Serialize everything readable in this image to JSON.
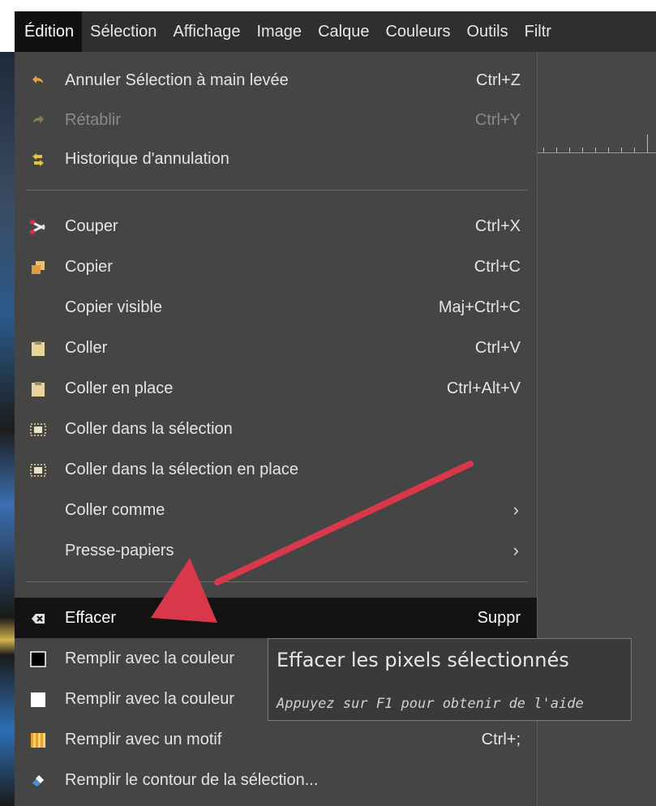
{
  "menubar": {
    "items": [
      "Édition",
      "Sélection",
      "Affichage",
      "Image",
      "Calque",
      "Couleurs",
      "Outils",
      "Filtr"
    ]
  },
  "edit_menu": {
    "items": [
      {
        "label": "Annuler Sélection à main levée",
        "shortcut": "Ctrl+Z",
        "icon": "undo-icon"
      },
      {
        "label": "Rétablir",
        "shortcut": "Ctrl+Y",
        "icon": "redo-icon"
      },
      {
        "label": "Historique d'annulation",
        "shortcut": "",
        "icon": "undo-history-icon"
      },
      {
        "label": "Couper",
        "shortcut": "Ctrl+X",
        "icon": "cut-icon"
      },
      {
        "label": "Copier",
        "shortcut": "Ctrl+C",
        "icon": "copy-icon"
      },
      {
        "label": "Copier visible",
        "shortcut": "Maj+Ctrl+C",
        "icon": ""
      },
      {
        "label": "Coller",
        "shortcut": "Ctrl+V",
        "icon": "paste-icon"
      },
      {
        "label": "Coller en place",
        "shortcut": "Ctrl+Alt+V",
        "icon": "paste-in-place-icon"
      },
      {
        "label": "Coller dans la sélection",
        "shortcut": "",
        "icon": "paste-into-icon"
      },
      {
        "label": "Coller dans la sélection en place",
        "shortcut": "",
        "icon": "paste-into-in-place-icon"
      },
      {
        "label": "Coller comme",
        "shortcut": "",
        "icon": ""
      },
      {
        "label": "Presse-papiers",
        "shortcut": "",
        "icon": ""
      },
      {
        "label": "Effacer",
        "shortcut": "Suppr",
        "icon": "clear-icon"
      },
      {
        "label": "Remplir avec la couleur",
        "shortcut": "",
        "icon": "fg-color-swatch-icon"
      },
      {
        "label": "Remplir avec la couleur",
        "shortcut": "",
        "icon": "bg-color-swatch-icon"
      },
      {
        "label": "Remplir avec un motif",
        "shortcut": "Ctrl+;",
        "icon": "pattern-icon"
      },
      {
        "label": "Remplir le contour de la sélection...",
        "shortcut": "",
        "icon": "stroke-selection-icon"
      }
    ]
  },
  "tooltip": {
    "title": "Effacer les pixels sélectionnés",
    "hint": "Appuyez sur F1 pour obtenir de l'aide"
  },
  "colors": {
    "menu_bg": "#454545",
    "highlight_bg": "#131313",
    "annotation_arrow": "#d9374a"
  }
}
